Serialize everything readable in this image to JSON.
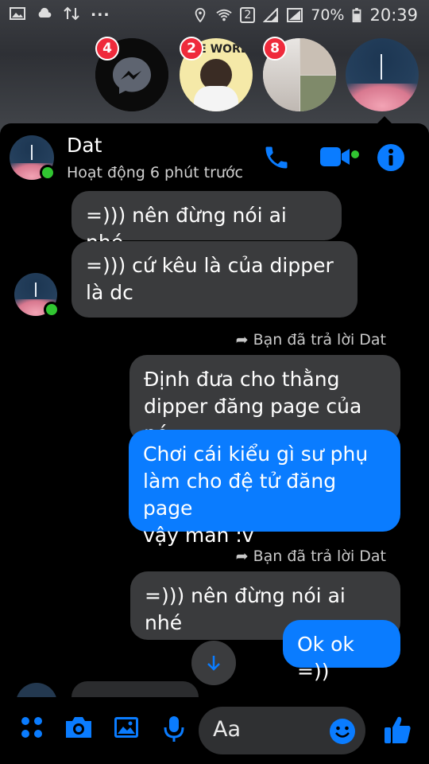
{
  "status_bar": {
    "battery": "70%",
    "time": "20:39",
    "sim_label": "2",
    "overflow": "..."
  },
  "chat_heads": [
    {
      "type": "messenger",
      "badge": "4"
    },
    {
      "type": "contact-photo",
      "badge": "2",
      "photo_text": "PE WORL"
    },
    {
      "type": "group-photo",
      "badge": "8"
    },
    {
      "type": "contact-avatar",
      "badge": ""
    }
  ],
  "header": {
    "name": "Dat",
    "status": "Hoạt động 6 phút trước"
  },
  "messages": [
    {
      "from": "them",
      "text": "=))) nên đừng nói ai nhé"
    },
    {
      "from": "them",
      "text": "=))) cứ kêu là của dipper\nlà dc"
    },
    {
      "reply_note": "Bạn đã trả lời Dat"
    },
    {
      "from": "quote",
      "text": "Định đưa cho thằng\ndipper đăng page của nó"
    },
    {
      "from": "me",
      "text": "Chơi cái kiểu gì sư phụ\nlàm cho đệ tử đăng page\nvậy man :v"
    },
    {
      "reply_note": "Bạn đã trả lời Dat"
    },
    {
      "from": "quote",
      "text": "=))) nên đừng nói ai nhé"
    },
    {
      "from": "me",
      "text": "Ok ok =))"
    }
  ],
  "composer": {
    "placeholder": "Aa"
  },
  "colors": {
    "accent": "#0a7cff",
    "bubble_grey": "#3a3b3d",
    "online": "#31c531",
    "badge": "#ef2a3b"
  },
  "icons": {
    "header": [
      "phone-icon",
      "video-icon",
      "info-icon"
    ],
    "composer": [
      "apps-icon",
      "camera-icon",
      "gallery-icon",
      "mic-icon",
      "emoji-icon",
      "like-icon"
    ]
  }
}
